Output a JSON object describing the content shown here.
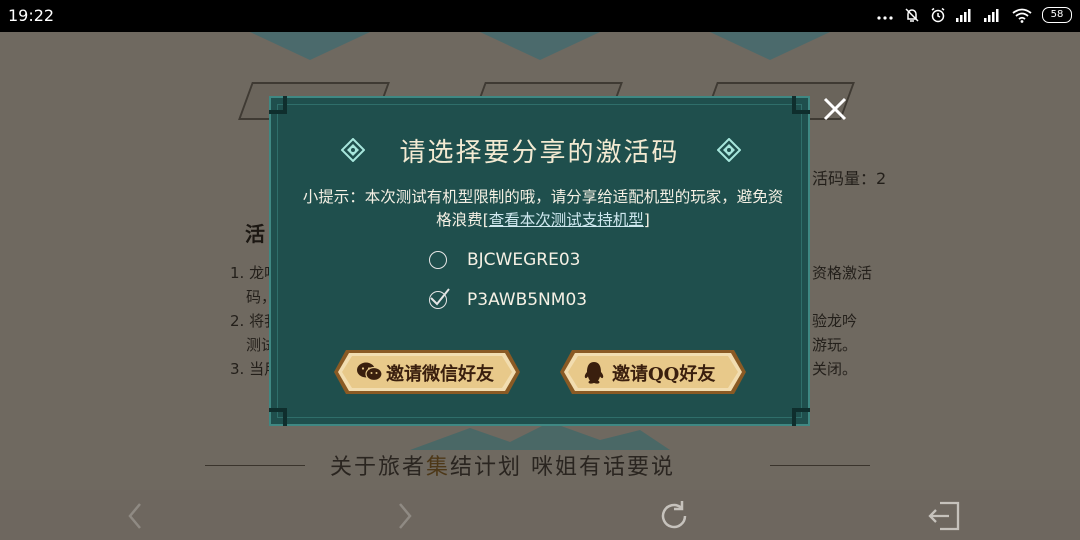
{
  "status_bar": {
    "time": "19:22",
    "battery": "58",
    "icons": [
      "more-dots-icon",
      "bell-off-icon",
      "alarm-icon",
      "signal-icon",
      "signal-icon",
      "wifi-icon",
      "battery-icon"
    ]
  },
  "background": {
    "counter_text": "活码量：2",
    "section_heading_partial": "活",
    "list_items_partial": [
      "1. 龙吟",
      "码，",
      "2. 将我",
      "测试",
      "3. 当用"
    ],
    "right_fragments": [
      "资格激活",
      "验龙吟",
      "游玩。",
      "关闭。"
    ],
    "footer_title_part1": "关于旅者",
    "footer_title_hl": "集",
    "footer_title_part2": "结计划  咪姐有话要说"
  },
  "dialog": {
    "title": "请选择要分享的激活码",
    "tip_prefix": "小提示：本次测试有机型限制的哦，请分享给适配机型的玩家，避免资格浪费",
    "tip_link_open": "[",
    "tip_link": "查看本次测试支持机型",
    "tip_link_close": "]",
    "codes": [
      {
        "code": "BJCWEGRE03",
        "selected": false
      },
      {
        "code": "P3AWB5NM03",
        "selected": true
      }
    ],
    "wechat_button": "邀请微信好友",
    "qq_button": "邀请QQ好友"
  },
  "colors": {
    "dialog_bg": "#1f4f4d",
    "dialog_border": "#3f8883",
    "button_gold": "#e8c98a",
    "button_text": "#3a1f0e"
  }
}
